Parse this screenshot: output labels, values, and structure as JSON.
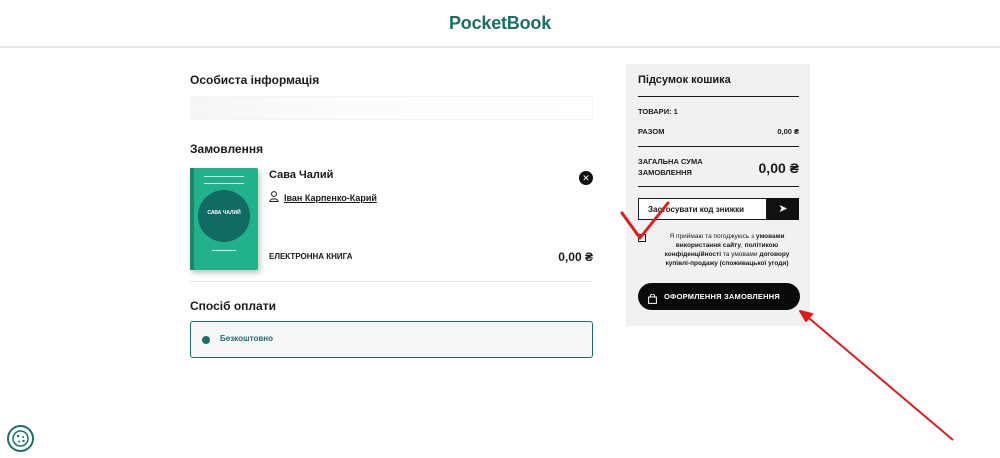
{
  "header": {
    "logo": "PocketBook"
  },
  "personal": {
    "title": "Особиста інформація"
  },
  "order": {
    "title": "Замовлення",
    "item": {
      "title": "Сава Чалий",
      "author": "Іван Карпенко-Карий",
      "format": "ЕЛЕКТРОННА КНИГА",
      "price": "0,00 ₴",
      "cover_title": "САВА ЧАЛИЙ",
      "remove_icon": "close-icon"
    }
  },
  "payment": {
    "title": "Спосіб оплати",
    "selected": "Безкоштовно"
  },
  "summary": {
    "title": "Підсумок кошика",
    "items_count": "ТОВАРИ: 1",
    "subtotal_label": "РАЗОМ",
    "subtotal_value": "0,00 ₴",
    "total_label": "ЗАГАЛЬНА СУМА ЗАМОВЛЕННЯ",
    "total_value": "0,00 ₴",
    "promo_label": "Застосувати код знижки",
    "consent": {
      "part1": "Я приймаю та погоджуюсь з",
      "link1": "умовами використання сайту",
      "part2": ",",
      "link2": "політикою конфіденційності",
      "part3": "та умовами",
      "link3": "договору купівлі-продажу (споживацької угоди)"
    },
    "order_button": "ОФОРМЛЕННЯ ЗАМОВЛЕННЯ"
  },
  "colors": {
    "brand": "#1b6f66",
    "accent": "#e11b1b",
    "cover": "#21b28c"
  }
}
